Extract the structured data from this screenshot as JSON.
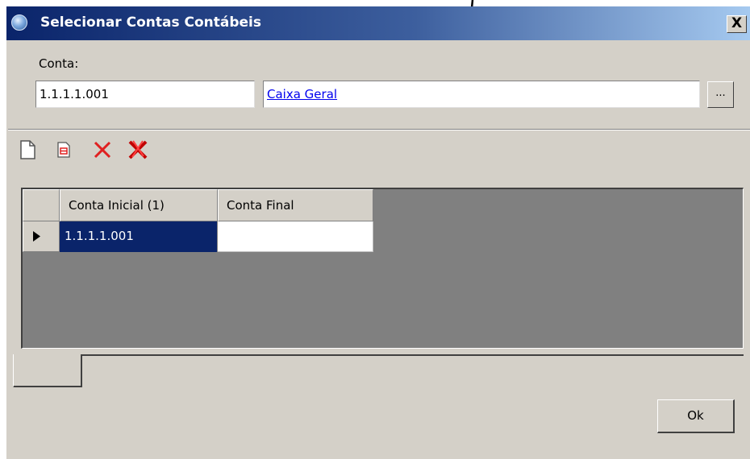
{
  "window": {
    "title": "Selecionar Contas Contábeis",
    "close_label": "X"
  },
  "conta": {
    "label": "Conta:",
    "code_value": "1.1.1.1.001",
    "description_value": "Caixa Geral",
    "browse_label": "..."
  },
  "toolbar": {
    "icons": [
      "new-document-icon",
      "edit-document-icon",
      "delete-icon",
      "delete-all-icon"
    ]
  },
  "grid": {
    "columns": [
      "Conta Inicial (1)",
      "Conta Final"
    ],
    "rows": [
      {
        "conta_inicial": "1.1.1.1.001",
        "conta_final": ""
      }
    ]
  },
  "footer": {
    "ok_label": "Ok"
  },
  "colors": {
    "title_bar_start": "#0a246a",
    "title_bar_end": "#a6caf0",
    "dialog_bg": "#d4d0c8",
    "selection": "#0a246a",
    "grid_bg": "#808080",
    "link": "#0000ee",
    "delete_red": "#e02020"
  }
}
